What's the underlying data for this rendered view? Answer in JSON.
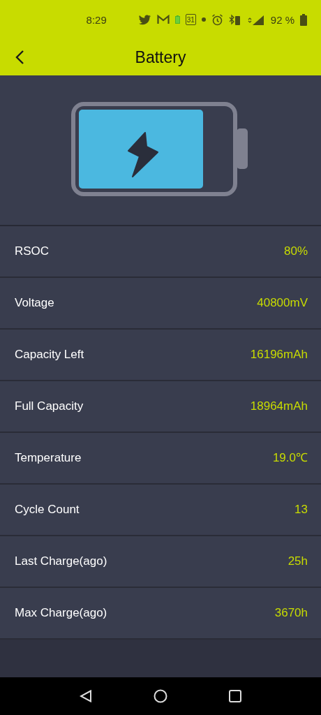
{
  "status_bar": {
    "time": "8:29",
    "calendar_day": "31",
    "battery_percent": "92 %"
  },
  "app_bar": {
    "title": "Battery"
  },
  "rows": [
    {
      "label": "RSOC",
      "value": "80%"
    },
    {
      "label": "Voltage",
      "value": "40800mV"
    },
    {
      "label": "Capacity Left",
      "value": "16196mAh"
    },
    {
      "label": "Full Capacity",
      "value": "18964mAh"
    },
    {
      "label": "Temperature",
      "value": "19.0℃"
    },
    {
      "label": "Cycle Count",
      "value": "13"
    },
    {
      "label": "Last Charge(ago)",
      "value": "25h"
    },
    {
      "label": "Max Charge(ago)",
      "value": "3670h"
    }
  ]
}
